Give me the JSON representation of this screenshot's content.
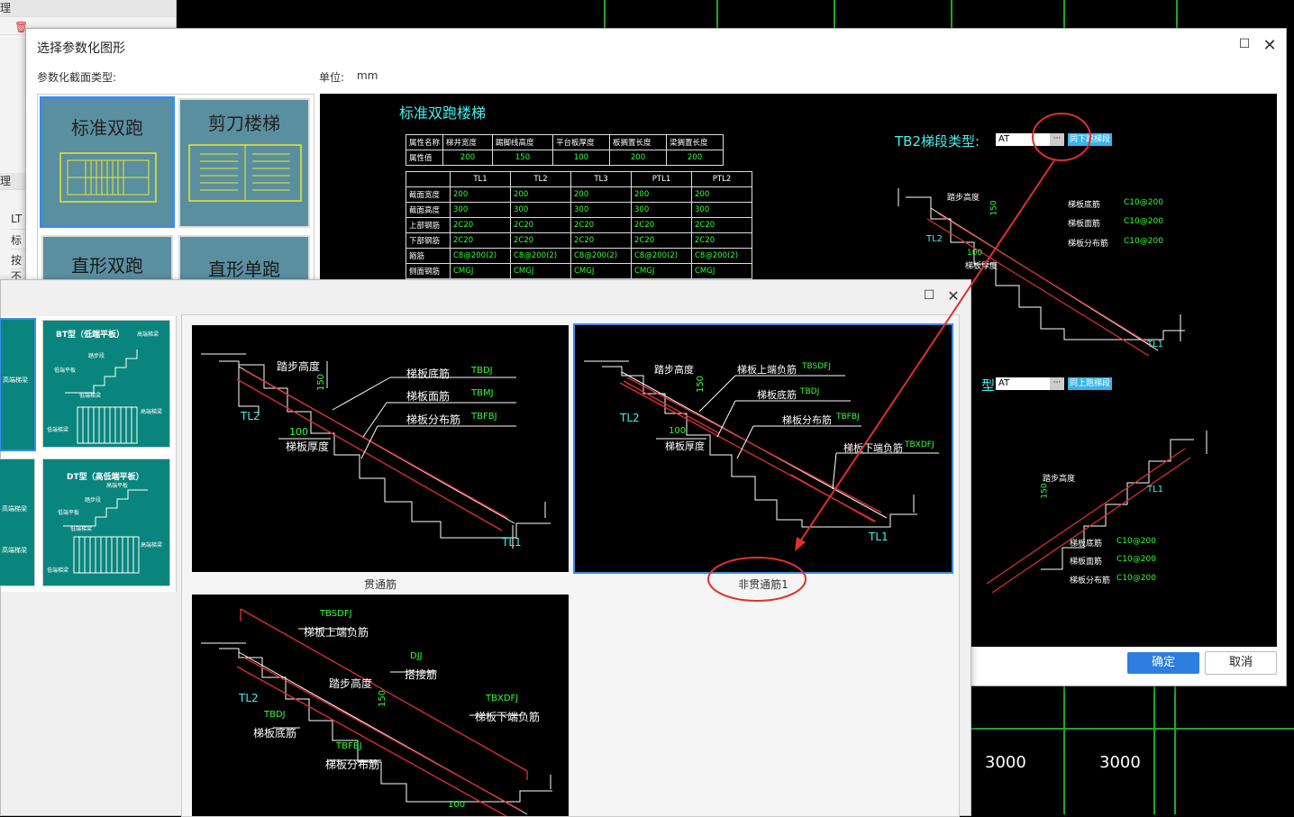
{
  "background": {
    "grid_numbers": [
      "3000",
      "3000"
    ],
    "left_panel": {
      "tab_a": "理",
      "tab_b": "理",
      "rows": [
        "LT",
        "标",
        "按",
        "不"
      ]
    }
  },
  "dialog_main": {
    "title": "选择参数化图形",
    "section_label": "参数化截面类型:",
    "unit_label": "单位:",
    "unit_value": "mm",
    "tiles": [
      "标准双跑",
      "剪刀楼梯",
      "直形双跑",
      "直形单跑"
    ],
    "preview": {
      "heading": "标准双跑楼梯",
      "table1": {
        "headers": [
          "属性名称",
          "梯井宽度",
          "踢脚线高度",
          "平台板厚度",
          "板搁置长度",
          "梁搁置长度"
        ],
        "values": [
          "属性值",
          "200",
          "150",
          "100",
          "200",
          "200"
        ]
      },
      "table2": {
        "headers": [
          "",
          "TL1",
          "TL2",
          "TL3",
          "PTL1",
          "PTL2"
        ],
        "rows": [
          [
            "截面宽度",
            "200",
            "200",
            "200",
            "200",
            "200"
          ],
          [
            "截面高度",
            "300",
            "300",
            "300",
            "300",
            "300"
          ],
          [
            "上部钢筋",
            "2C20",
            "2C20",
            "2C20",
            "2C20",
            "2C20"
          ],
          [
            "下部钢筋",
            "2C20",
            "2C20",
            "2C20",
            "2C20",
            "2C20"
          ],
          [
            "箍筋",
            "C8@200(2)",
            "C8@200(2)",
            "C8@200(2)",
            "C8@200(2)",
            "C8@200(2)"
          ],
          [
            "侧面钢筋",
            "CMGJ",
            "CMGJ",
            "CMGJ",
            "CMGJ",
            "CMGJ"
          ]
        ]
      },
      "tb2_label": "TB2梯段类型:",
      "tb2_value": "AT",
      "tb2_btn": "同下跑梯段",
      "tb1_label_suffix": "型:",
      "tb1_value": "AT",
      "tb1_btn": "同上跑梯段",
      "stair1": {
        "step_height": "踏步高度",
        "h150": "150",
        "tl2": "TL2",
        "tl1": "TL1",
        "t100": "100",
        "thickness": "梯板厚度",
        "bottom_bar": "梯板底筋",
        "bottom_val": "C10@200",
        "top_bar": "梯板面筋",
        "top_val": "C10@200",
        "dist_bar": "梯板分布筋",
        "dist_val": "C10@200"
      },
      "stair2": {
        "step_height": "踏步高度",
        "h150": "150",
        "tl1": "TL1",
        "bottom_bar": "梯板底筋",
        "bottom_val": "C10@200",
        "top_bar": "梯板面筋",
        "top_val": "C10@200",
        "dist_bar": "梯板分布筋",
        "dist_val": "C10@200"
      }
    },
    "ok": "确定",
    "cancel": "取消"
  },
  "dialog_sub": {
    "teal_tiles": [
      {
        "title": "BT型（低端平板）",
        "labels": [
          "高端梯梁",
          "踏步段",
          "低端平板",
          "低端梯梁",
          "高端梯梁",
          "低端梯梁"
        ]
      },
      {
        "title": "DT型（高低端平板）",
        "labels": [
          "高端平板",
          "踏步段",
          "低端平板",
          "低端梯梁",
          "高端梯梁",
          "低端梯梁"
        ]
      }
    ],
    "teal_left_labels": [
      "高端梯梁",
      "高端梯梁",
      "高端梯梁"
    ],
    "options": [
      {
        "caption": "贯通筋",
        "labels": {
          "step_height": "踏步高度",
          "h150": "150",
          "tl2": "TL2",
          "tl1": "TL1",
          "t100": "100",
          "thickness": "梯板厚度",
          "bottom": "梯板底筋",
          "bottom_code": "TBDJ",
          "top": "梯板面筋",
          "top_code": "TBMJ",
          "dist": "梯板分布筋",
          "dist_code": "TBFBJ"
        }
      },
      {
        "caption": "非贯通筋1",
        "labels": {
          "step_height": "踏步高度",
          "h150": "150",
          "tl2": "TL2",
          "tl1": "TL1",
          "t100": "100",
          "thickness": "梯板厚度",
          "upper_neg": "梯板上端负筋",
          "upper_neg_code": "TBSDFJ",
          "bottom": "梯板底筋",
          "bottom_code": "TBDJ",
          "dist": "梯板分布筋",
          "dist_code": "TBFBJ",
          "lower_neg": "梯板下端负筋",
          "lower_neg_code": "TBXDFJ"
        }
      },
      {
        "caption": "",
        "labels": {
          "upper_neg_code": "TBSDFJ",
          "upper_neg": "梯板上端负筋",
          "djj_code": "DJJ",
          "djj": "搭接筋",
          "step_height": "踏步高度",
          "h150": "150",
          "tl2": "TL2",
          "bottom_code": "TBDJ",
          "bottom": "梯板底筋",
          "lower_neg_code": "TBXDFJ",
          "lower_neg": "梯板下端负筋",
          "dist_code": "TBFBJ",
          "dist": "梯板分布筋",
          "t100": "100"
        }
      }
    ]
  },
  "colors": {
    "accent": "#2d7ee0",
    "annotation_red": "#e03030",
    "cad_green": "#1fa81f",
    "tile_blue": "#5a8fa0",
    "teal": "#0a857e"
  }
}
